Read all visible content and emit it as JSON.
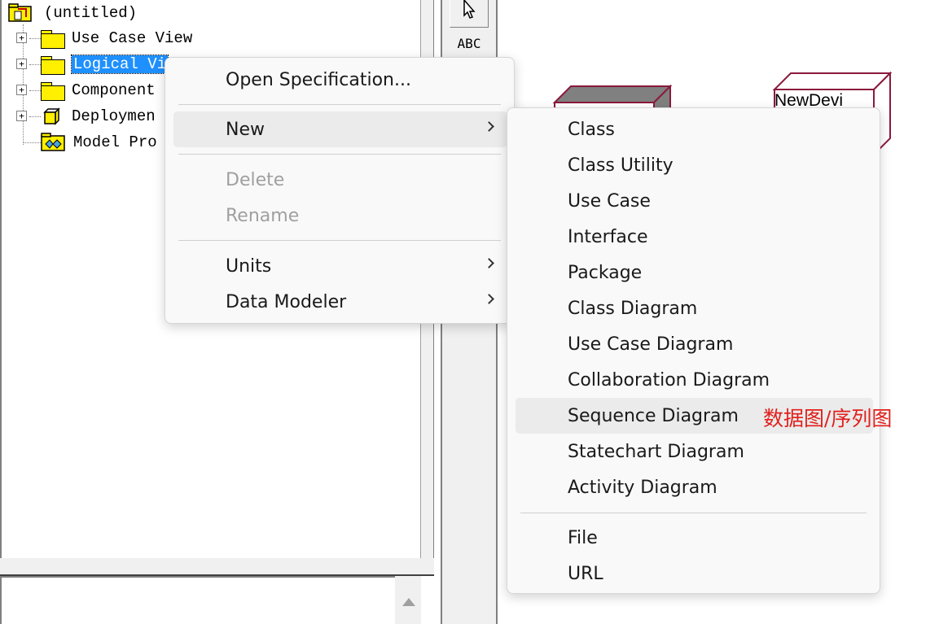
{
  "browser": {
    "root_label": "(untitled)",
    "items": [
      {
        "label": "Use Case View"
      },
      {
        "label": "Logical Vi"
      },
      {
        "label": "Component"
      },
      {
        "label": "Deploymen"
      },
      {
        "label": "Model Pro"
      }
    ],
    "expander_symbol": "+"
  },
  "toolbox": {
    "text_tool_label": "ABC"
  },
  "canvas": {
    "device_label": "NewDevi",
    "processor_fill": "#808080",
    "node_outline": "#8b1a3c"
  },
  "context_menu": {
    "items": [
      {
        "label": "Open Specification..."
      },
      {
        "label": "New"
      },
      {
        "label": "Delete"
      },
      {
        "label": "Rename"
      },
      {
        "label": "Units"
      },
      {
        "label": "Data Modeler"
      }
    ]
  },
  "submenu_new": {
    "items": [
      {
        "label": "Class"
      },
      {
        "label": "Class Utility"
      },
      {
        "label": "Use Case"
      },
      {
        "label": "Interface"
      },
      {
        "label": "Package"
      },
      {
        "label": "Class Diagram"
      },
      {
        "label": "Use Case Diagram"
      },
      {
        "label": "Collaboration Diagram"
      },
      {
        "label": "Sequence Diagram"
      },
      {
        "label": "Statechart Diagram"
      },
      {
        "label": "Activity Diagram"
      },
      {
        "label": "File"
      },
      {
        "label": "URL"
      }
    ]
  },
  "annotation": {
    "text": "数据图/序列图",
    "color": "#e0201c"
  }
}
